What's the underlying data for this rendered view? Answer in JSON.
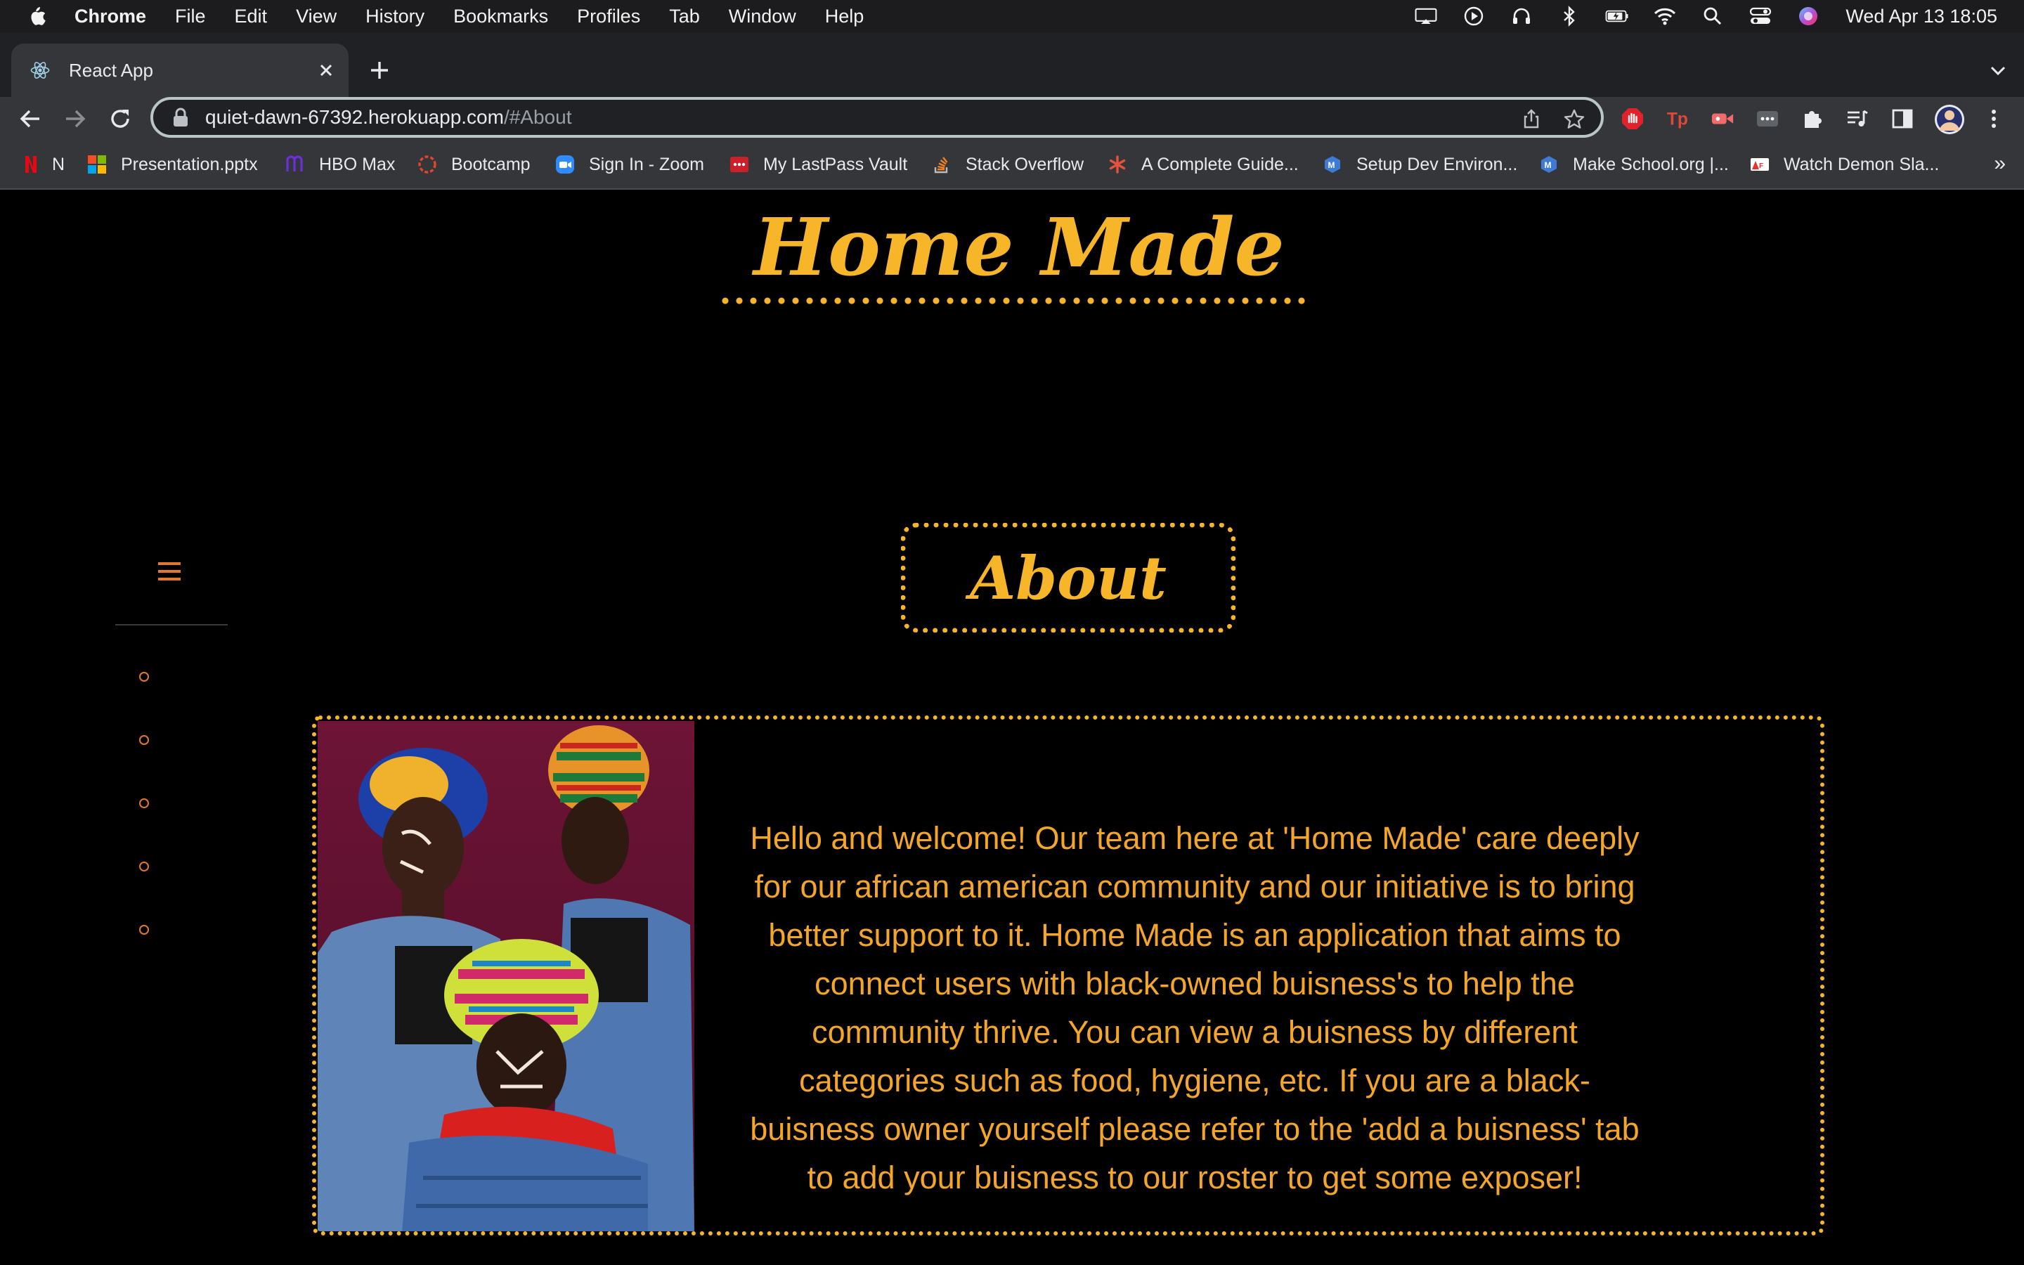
{
  "menubar": {
    "app": "Chrome",
    "items": [
      "File",
      "Edit",
      "View",
      "History",
      "Bookmarks",
      "Profiles",
      "Tab",
      "Window",
      "Help"
    ],
    "clock": "Wed Apr 13  18:05"
  },
  "tab": {
    "title": "React App"
  },
  "address": {
    "host": "quiet-dawn-67392.herokuapp.com",
    "path": "/#About"
  },
  "bookmarks": [
    {
      "label": "N",
      "icon": "netflix-icon"
    },
    {
      "label": "Presentation.pptx",
      "icon": "microsoft-icon"
    },
    {
      "label": "HBO Max",
      "icon": "hbo-icon"
    },
    {
      "label": "Bootcamp",
      "icon": "bootcamp-icon"
    },
    {
      "label": "Sign In - Zoom",
      "icon": "zoom-icon"
    },
    {
      "label": "My LastPass Vault",
      "icon": "lastpass-icon"
    },
    {
      "label": "Stack Overflow",
      "icon": "stackoverflow-icon"
    },
    {
      "label": "A Complete Guide...",
      "icon": "asterisk-icon"
    },
    {
      "label": "Setup Dev Environ...",
      "icon": "makeschool-icon"
    },
    {
      "label": "Make School.org |...",
      "icon": "makeschool-icon"
    },
    {
      "label": "Watch Demon Sla...",
      "icon": "anime-icon"
    }
  ],
  "bookmarks_more": "»",
  "site": {
    "brand": "Home Made",
    "section_title": "About",
    "about_text": "Hello and welcome! Our team here at 'Home Made' care deeply for our african american community and our initiative is to bring better support to it. Home Made is an application that aims to connect users with black-owned buisness's to help the community thrive. You can view a buisness by different categories such as food, hygiene, etc. If you are a black-buisness owner yourself please refer to the 'add a buisness' tab to add your buisness to our roster to get some exposer!"
  },
  "colors": {
    "accent": "#f7b62a",
    "text": "#f4a62a",
    "nav_dot": "#e1782e",
    "background": "#000000"
  }
}
